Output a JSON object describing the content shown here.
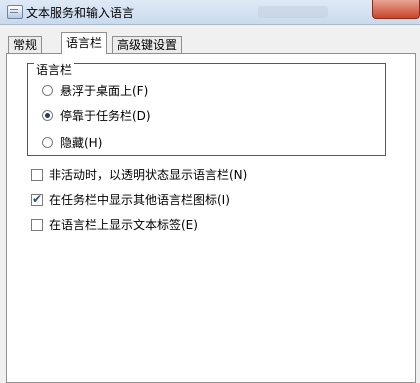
{
  "window": {
    "title": "文本服务和输入语言"
  },
  "tabs": [
    {
      "label": "常规"
    },
    {
      "label": "语言栏"
    },
    {
      "label": "高级键设置"
    }
  ],
  "language_bar_group": {
    "title": "语言栏",
    "options": [
      {
        "label": "悬浮于桌面上(F)",
        "selected": false
      },
      {
        "label": "停靠于任务栏(D)",
        "selected": true
      },
      {
        "label": "隐藏(H)",
        "selected": false
      }
    ]
  },
  "checkboxes": [
    {
      "label": "非活动时，以透明状态显示语言栏(N)",
      "checked": false
    },
    {
      "label": "在任务栏中显示其他语言栏图标(I)",
      "checked": true
    },
    {
      "label": "在语言栏上显示文本标签(E)",
      "checked": false
    }
  ],
  "colors": {
    "group_highlight": "#d6202a",
    "selection": "#1f3f6c"
  }
}
